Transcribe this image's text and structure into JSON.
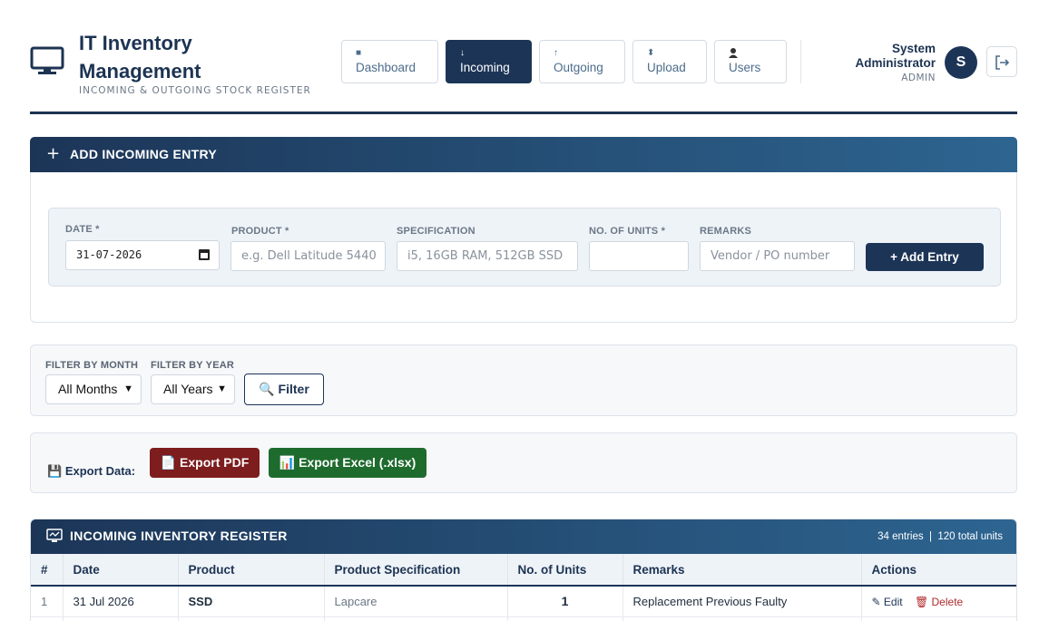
{
  "app": {
    "title": "IT Inventory Management",
    "subtitle": "INCOMING & OUTGOING STOCK REGISTER"
  },
  "nav": [
    {
      "label": "Dashboard",
      "icon": "square-icon",
      "active": false
    },
    {
      "label": "Incoming",
      "icon": "arrow-down-icon",
      "active": true
    },
    {
      "label": "Outgoing",
      "icon": "arrow-up-icon",
      "active": false
    },
    {
      "label": "Upload",
      "icon": "arrow-updown-icon",
      "active": false
    },
    {
      "label": "Users",
      "icon": "user-icon",
      "active": false
    }
  ],
  "user": {
    "name": "System Administrator",
    "role": "ADMIN",
    "initial": "S"
  },
  "add_entry": {
    "title": "ADD INCOMING ENTRY",
    "fields": {
      "date": {
        "label": "DATE *",
        "value": "31-07-2026"
      },
      "product": {
        "label": "PRODUCT *",
        "placeholder": "e.g. Dell Latitude 5440"
      },
      "spec": {
        "label": "SPECIFICATION",
        "placeholder": "i5, 16GB RAM, 512GB SSD"
      },
      "units": {
        "label": "NO. OF UNITS *",
        "placeholder": ""
      },
      "remarks": {
        "label": "REMARKS",
        "placeholder": "Vendor / PO number"
      }
    },
    "submit_label": "+ Add Entry"
  },
  "filter": {
    "month_label": "FILTER BY MONTH",
    "month_value": "All Months",
    "year_label": "FILTER BY YEAR",
    "year_value": "All Years",
    "button_label": "Filter"
  },
  "export": {
    "label": "Export Data:",
    "pdf_label": "Export PDF",
    "excel_label": "Export Excel (.xlsx)"
  },
  "register": {
    "title": "INCOMING INVENTORY REGISTER",
    "entries": "34 entries",
    "total_units": "120 total units",
    "columns": [
      "#",
      "Date",
      "Product",
      "Product Specification",
      "No. of Units",
      "Remarks",
      "Actions"
    ],
    "rows": [
      {
        "num": "1",
        "date": "31 Jul 2026",
        "product": "SSD",
        "spec": "Lapcare",
        "units": "1",
        "remarks": "Replacement Previous Faulty"
      }
    ],
    "edit_label": "Edit",
    "delete_label": "Delete"
  },
  "colors": {
    "primary": "#1c3557",
    "pdf": "#7d1d1d",
    "excel": "#1e6b2e",
    "delete": "#b02a2a"
  }
}
